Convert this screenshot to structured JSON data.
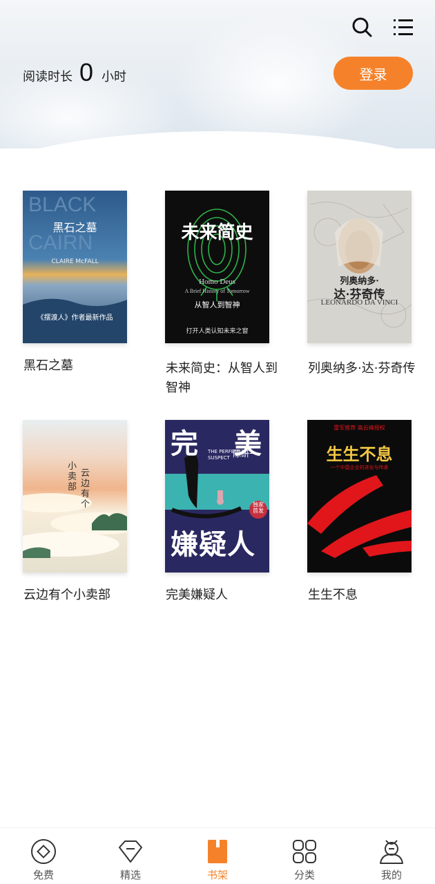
{
  "header": {
    "reading_label": "阅读时长",
    "reading_value": "0",
    "reading_unit": "小时",
    "login_label": "登录",
    "search_icon": "search-icon",
    "menu_icon": "list-menu-icon"
  },
  "books": [
    {
      "title": "黑石之墓",
      "cover_title": "黑石之墓",
      "cover_author": "CLAIRE McFALL",
      "cover_line": "《摆渡人》作者最新作品"
    },
    {
      "title": "未来简史：从智人到智神",
      "cover_title": "未来简史",
      "cover_subtitle_en": "Homo Deus",
      "cover_subtitle_en2": "A Brief History of Tomorrow",
      "cover_subtitle": "从智人到智神",
      "cover_line": "打开人类认知未来之窗"
    },
    {
      "title": "列奥纳多·达·芬奇传",
      "cover_title1": "列奥纳多·",
      "cover_title2": "达·芬奇传",
      "cover_author": "LEONARDO DA VINCI"
    },
    {
      "title": "云边有个小卖部",
      "cover_title1": "云边有个",
      "cover_title2": "小卖部"
    },
    {
      "title": "完美嫌疑人",
      "cover_t1": "完",
      "cover_t2": "美",
      "cover_t3": "嫌疑人",
      "cover_en1": "THE PERFECT",
      "cover_en2": "SUSPECT",
      "cover_author": "陈研一",
      "cover_badge1": "独家",
      "cover_badge2": "首发"
    },
    {
      "title": "生生不息",
      "cover_title": "生生不息",
      "cover_top": "雷军推荐 高云峰授权",
      "cover_sub": "一个中国企业的进化与传承"
    }
  ],
  "tabs": [
    {
      "label": "免费",
      "icon": "coin-icon"
    },
    {
      "label": "精选",
      "icon": "diamond-icon"
    },
    {
      "label": "书架",
      "icon": "bookshelf-icon"
    },
    {
      "label": "分类",
      "icon": "grid-icon"
    },
    {
      "label": "我的",
      "icon": "profile-icon"
    }
  ],
  "colors": {
    "accent": "#f5822a",
    "text": "#222222"
  }
}
